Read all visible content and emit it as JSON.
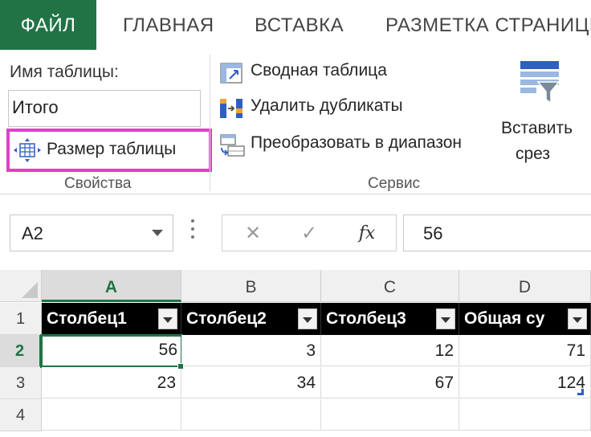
{
  "tabs": [
    {
      "label": "ФАЙЛ",
      "active": true
    },
    {
      "label": "ГЛАВНАЯ"
    },
    {
      "label": "ВСТАВКА"
    },
    {
      "label": "РАЗМЕТКА СТРАНИЦЫ"
    }
  ],
  "ribbon": {
    "properties": {
      "name_label": "Имя таблицы:",
      "name_value": "Итого",
      "resize_label": "Размер таблицы",
      "group_label": "Свойства"
    },
    "tools": {
      "pivot_label": "Сводная таблица",
      "remove_dup_label": "Удалить дубликаты",
      "convert_label": "Преобразовать в диапазон",
      "group_label": "Сервис"
    },
    "slicer": {
      "line1": "Вставить",
      "line2": "срез"
    }
  },
  "formula_bar": {
    "name_box": "A2",
    "value": "56",
    "fx": "fx"
  },
  "sheet": {
    "columns": [
      "A",
      "B",
      "C",
      "D"
    ],
    "rows": [
      "1",
      "2",
      "3",
      "4"
    ],
    "active_cell": "A2",
    "table_headers": [
      "Столбец1",
      "Столбец2",
      "Столбец3",
      "Общая су"
    ],
    "data": [
      [
        "56",
        "3",
        "12",
        "71"
      ],
      [
        "23",
        "34",
        "67",
        "124"
      ]
    ]
  },
  "colors": {
    "accent": "#217346",
    "highlight": "#e23ec7",
    "table_header_bg": "#000000"
  }
}
